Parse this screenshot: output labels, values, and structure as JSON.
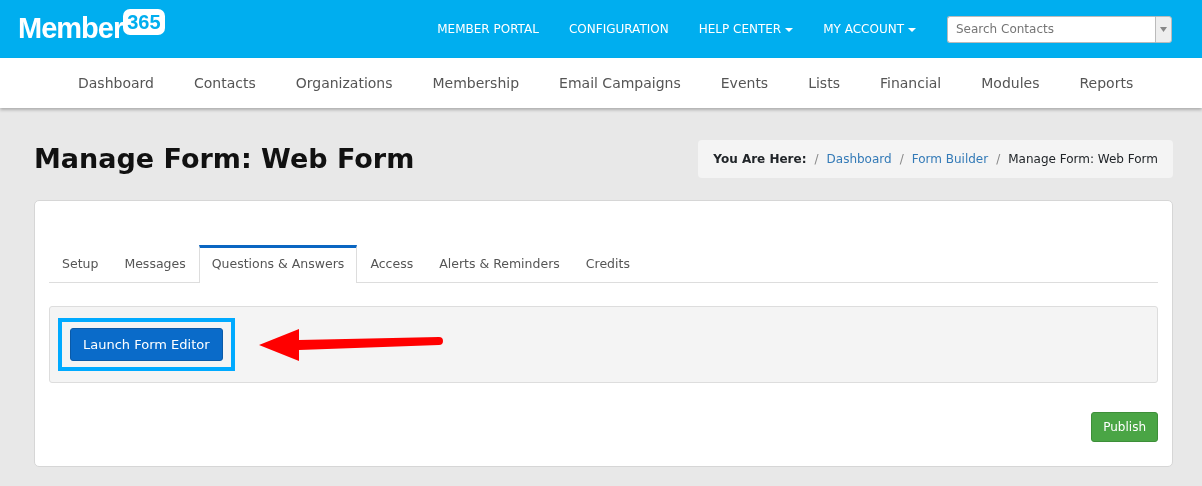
{
  "logo": {
    "word": "Member",
    "badge": "365"
  },
  "top_nav": [
    {
      "label": "MEMBER PORTAL",
      "dropdown": false
    },
    {
      "label": "CONFIGURATION",
      "dropdown": false
    },
    {
      "label": "HELP CENTER",
      "dropdown": true
    },
    {
      "label": "MY ACCOUNT",
      "dropdown": true
    }
  ],
  "search": {
    "placeholder": "Search Contacts"
  },
  "main_nav": [
    "Dashboard",
    "Contacts",
    "Organizations",
    "Membership",
    "Email Campaigns",
    "Events",
    "Lists",
    "Financial",
    "Modules",
    "Reports"
  ],
  "page_title": "Manage Form: Web Form",
  "breadcrumb": {
    "label": "You Are Here:",
    "separator": "/",
    "items": [
      {
        "text": "Dashboard",
        "link": true
      },
      {
        "text": "Form Builder",
        "link": true
      },
      {
        "text": "Manage Form: Web Form",
        "link": false
      }
    ]
  },
  "tabs": [
    {
      "label": "Setup",
      "selected": false
    },
    {
      "label": "Messages",
      "selected": false
    },
    {
      "label": "Questions & Answers",
      "selected": true
    },
    {
      "label": "Access",
      "selected": false
    },
    {
      "label": "Alerts & Reminders",
      "selected": false
    },
    {
      "label": "Credits",
      "selected": false
    }
  ],
  "launch_button": {
    "label": "Launch Form Editor",
    "highlighted": true
  },
  "publish_button": {
    "label": "Publish"
  }
}
